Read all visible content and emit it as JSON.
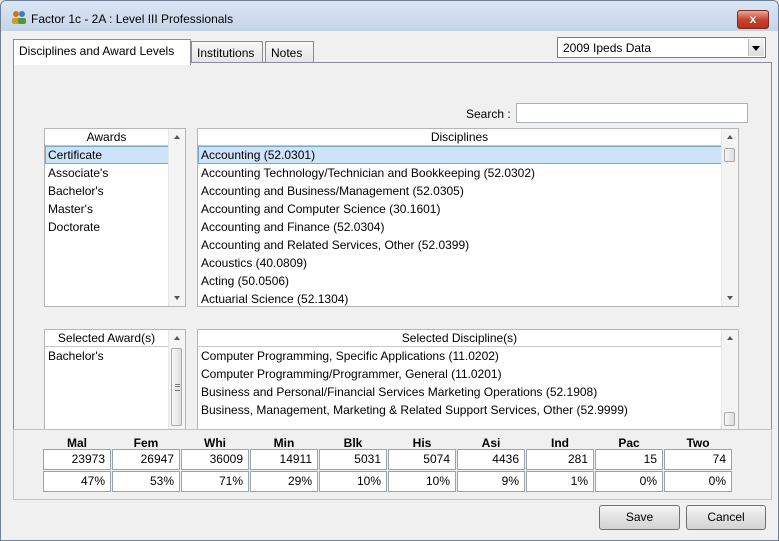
{
  "window": {
    "title": "Factor 1c - 2A : Level III Professionals",
    "close_label": "x"
  },
  "tabs": [
    {
      "label": "Disciplines and Award Levels",
      "active": true
    },
    {
      "label": "Institutions",
      "active": false
    },
    {
      "label": "Notes",
      "active": false
    }
  ],
  "data_source": {
    "selected": "2009 Ipeds Data"
  },
  "search": {
    "label": "Search :",
    "value": ""
  },
  "awards": {
    "header": "Awards",
    "items": [
      "Certificate",
      "Associate's",
      "Bachelor's",
      "Master's",
      "Doctorate"
    ],
    "selected_index": 0
  },
  "disciplines": {
    "header": "Disciplines",
    "items": [
      "Accounting (52.0301)",
      "Accounting Technology/Technician and Bookkeeping (52.0302)",
      "Accounting and Business/Management (52.0305)",
      "Accounting and Computer Science (30.1601)",
      "Accounting and Finance (52.0304)",
      "Accounting and Related Services, Other (52.0399)",
      "Acoustics (40.0809)",
      "Acting (50.0506)",
      "Actuarial Science (52.1304)"
    ],
    "selected_index": 0
  },
  "selected_awards": {
    "header": "Selected Award(s)",
    "items": [
      "Bachelor's"
    ]
  },
  "selected_disciplines": {
    "header": "Selected Discipline(s)",
    "items": [
      "Computer Programming, Specific Applications (11.0202)",
      "Computer Programming/Programmer, General (11.0201)",
      "Business and Personal/Financial Services Marketing Operations (52.1908)",
      "Business, Management, Marketing & Related Support Services, Other (52.9999)"
    ]
  },
  "stats": [
    {
      "label": "Mal",
      "count": "23973",
      "pct": "47%"
    },
    {
      "label": "Fem",
      "count": "26947",
      "pct": "53%"
    },
    {
      "label": "Whi",
      "count": "36009",
      "pct": "71%"
    },
    {
      "label": "Min",
      "count": "14911",
      "pct": "29%"
    },
    {
      "label": "Blk",
      "count": "5031",
      "pct": "10%"
    },
    {
      "label": "His",
      "count": "5074",
      "pct": "10%"
    },
    {
      "label": "Asi",
      "count": "4436",
      "pct": "9%"
    },
    {
      "label": "Ind",
      "count": "281",
      "pct": "1%"
    },
    {
      "label": "Pac",
      "count": "15",
      "pct": "0%"
    },
    {
      "label": "Two",
      "count": "74",
      "pct": "0%"
    }
  ],
  "buttons": {
    "save": "Save",
    "cancel": "Cancel"
  },
  "colors": {
    "selection": "#cde3f7",
    "close": "#c8452f"
  }
}
